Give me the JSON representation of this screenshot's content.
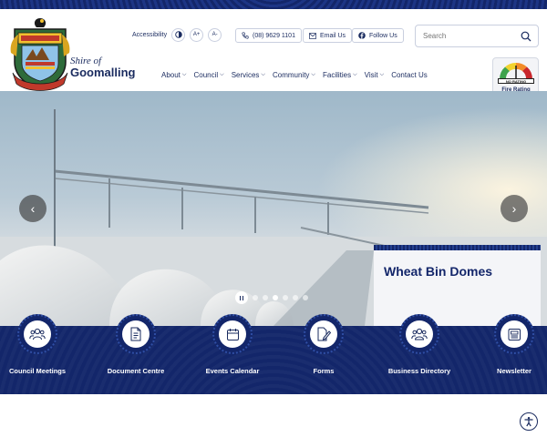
{
  "brand": {
    "small": "Shire of",
    "big": "Goomalling"
  },
  "utility": {
    "accessibility_label": "Accessibility",
    "contrast_icon": "contrast-icon",
    "font_up": "A+",
    "font_down": "A-",
    "phone": "(08) 9629 1101",
    "email": "Email Us",
    "follow": "Follow Us"
  },
  "search": {
    "placeholder": "Search"
  },
  "nav": {
    "items": [
      {
        "label": "About",
        "has_menu": true
      },
      {
        "label": "Council",
        "has_menu": true
      },
      {
        "label": "Services",
        "has_menu": true
      },
      {
        "label": "Community",
        "has_menu": true
      },
      {
        "label": "Facilities",
        "has_menu": true
      },
      {
        "label": "Visit",
        "has_menu": true
      },
      {
        "label": "Contact Us",
        "has_menu": false
      }
    ],
    "chevron": "⌵"
  },
  "fire": {
    "rating": "NO RATING",
    "caption": "Fire Rating"
  },
  "hero": {
    "slide_title": "Wheat Bin Domes",
    "prev": "‹",
    "next": "›",
    "dots_count": 6,
    "active_dot": 3
  },
  "quick_links": [
    {
      "label": "Council Meetings",
      "icon": "people-icon"
    },
    {
      "label": "Document Centre",
      "icon": "document-icon"
    },
    {
      "label": "Events Calendar",
      "icon": "calendar-icon"
    },
    {
      "label": "Forms",
      "icon": "form-edit-icon"
    },
    {
      "label": "Business Directory",
      "icon": "business-people-icon"
    },
    {
      "label": "Newsletter",
      "icon": "newsletter-icon"
    }
  ],
  "colors": {
    "navy": "#13266a",
    "text": "#1a2b5f",
    "white": "#ffffff"
  }
}
